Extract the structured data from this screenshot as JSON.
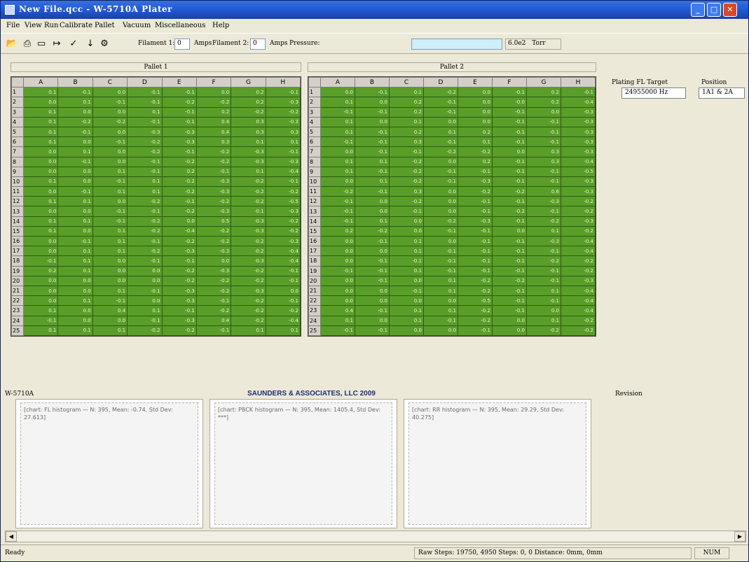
{
  "window": {
    "title": "New File.qcc - W-5710A Plater"
  },
  "menu": [
    "File",
    "View",
    "Run",
    "Calibrate",
    "Pallet",
    "Vacuum",
    "Miscellaneous",
    "Help"
  ],
  "toolbar": {
    "filament1_label": "Filament 1:",
    "filament1_value": "0",
    "amps1_label": "Amps",
    "filament2_label": "Filament 2:",
    "filament2_value": "0",
    "amps2_label": "Amps",
    "pressure_label": "Pressure:",
    "pressure_value": "",
    "pressure_reading": "6.0e2",
    "pressure_unit": "Torr",
    "icons": [
      "open-folder-icon",
      "print-icon",
      "new-document-icon",
      "probe-icon",
      "checkmark-icon",
      "pin-icon",
      "motor-icon"
    ]
  },
  "pallets": [
    {
      "title": "Pallet 1",
      "columns": [
        "A",
        "B",
        "C",
        "D",
        "E",
        "F",
        "G",
        "H"
      ],
      "rows": [
        [
          "0.1",
          "-0.1",
          "0.0",
          "-0.1",
          "-0.1",
          "0.0",
          "0.2",
          "-0.1"
        ],
        [
          "0.0",
          "0.1",
          "-0.1",
          "-0.1",
          "-0.2",
          "-0.2",
          "0.2",
          "-0.3"
        ],
        [
          "0.1",
          "0.0",
          "0.0",
          "0.1",
          "-0.1",
          "0.2",
          "-0.2",
          "-0.2"
        ],
        [
          "0.1",
          "-0.2",
          "-0.2",
          "-0.1",
          "-0.1",
          "0.4",
          "0.3",
          "-0.3"
        ],
        [
          "0.1",
          "-0.1",
          "0.0",
          "-0.3",
          "-0.3",
          "0.4",
          "0.3",
          "0.3"
        ],
        [
          "0.1",
          "0.0",
          "-0.1",
          "-0.2",
          "-0.3",
          "0.3",
          "0.1",
          "0.1"
        ],
        [
          "0.0",
          "0.1",
          "0.0",
          "-0.2",
          "-0.1",
          "-0.2",
          "-0.3",
          "-0.1"
        ],
        [
          "0.0",
          "-0.1",
          "0.0",
          "-0.1",
          "-0.2",
          "-0.2",
          "-0.3",
          "-0.3"
        ],
        [
          "0.0",
          "0.0",
          "0.1",
          "-0.1",
          "0.2",
          "-0.1",
          "0.1",
          "-0.4"
        ],
        [
          "0.1",
          "0.0",
          "-0.1",
          "0.1",
          "-0.2",
          "-0.3",
          "-0.2",
          "-0.1"
        ],
        [
          "0.0",
          "-0.1",
          "0.1",
          "0.1",
          "-0.2",
          "-0.3",
          "-0.2",
          "-0.2"
        ],
        [
          "0.1",
          "0.1",
          "0.0",
          "-0.2",
          "-0.1",
          "-0.2",
          "-0.2",
          "-0.5"
        ],
        [
          "0.0",
          "0.0",
          "-0.1",
          "-0.1",
          "-0.2",
          "-0.3",
          "-0.1",
          "-0.3"
        ],
        [
          "0.1",
          "0.1",
          "-0.1",
          "-0.2",
          "0.0",
          "0.5",
          "-0.3",
          "-0.2"
        ],
        [
          "0.1",
          "0.0",
          "0.1",
          "-0.2",
          "-0.4",
          "-0.2",
          "-0.3",
          "-0.2"
        ],
        [
          "0.0",
          "-0.1",
          "0.1",
          "-0.1",
          "-0.2",
          "-0.2",
          "-0.2",
          "-0.3"
        ],
        [
          "0.0",
          "0.1",
          "0.1",
          "-0.2",
          "-0.3",
          "-0.3",
          "-0.2",
          "-0.4"
        ],
        [
          "-0.1",
          "0.1",
          "0.0",
          "-0.1",
          "-0.1",
          "0.0",
          "-0.3",
          "-0.4"
        ],
        [
          "0.2",
          "0.1",
          "0.0",
          "0.0",
          "-0.2",
          "-0.3",
          "-0.2",
          "-0.1"
        ],
        [
          "0.0",
          "0.0",
          "0.0",
          "0.0",
          "-0.2",
          "-0.2",
          "-0.2",
          "-0.1"
        ],
        [
          "0.0",
          "0.0",
          "0.1",
          "-0.1",
          "-0.3",
          "-0.2",
          "-0.3",
          "0.0"
        ],
        [
          "0.0",
          "0.1",
          "-0.1",
          "0.0",
          "-0.3",
          "-0.1",
          "-0.2",
          "-0.1"
        ],
        [
          "0.1",
          "0.0",
          "0.4",
          "0.1",
          "-0.1",
          "-0.2",
          "-0.2",
          "-0.2"
        ],
        [
          "-0.1",
          "0.0",
          "0.0",
          "-0.1",
          "-0.3",
          "0.4",
          "-0.2",
          "-0.4"
        ],
        [
          "0.1",
          "0.1",
          "0.1",
          "-0.2",
          "-0.2",
          "-0.1",
          "0.1",
          "0.1"
        ]
      ]
    },
    {
      "title": "Pallet 2",
      "columns": [
        "A",
        "B",
        "C",
        "D",
        "E",
        "F",
        "G",
        "H"
      ],
      "rows": [
        [
          "0.0",
          "-0.1",
          "0.1",
          "-0.2",
          "0.0",
          "-0.1",
          "0.2",
          "-0.1"
        ],
        [
          "0.1",
          "0.0",
          "0.2",
          "-0.1",
          "0.0",
          "-0.0",
          "0.2",
          "-0.4"
        ],
        [
          "-0.1",
          "-0.1",
          "0.2",
          "-0.1",
          "0.0",
          "-0.1",
          "0.0",
          "-0.3"
        ],
        [
          "0.1",
          "0.0",
          "0.1",
          "0.0",
          "0.0",
          "-0.1",
          "-0.1",
          "-0.3"
        ],
        [
          "0.1",
          "-0.1",
          "0.2",
          "0.1",
          "0.2",
          "-0.1",
          "-0.1",
          "-0.3"
        ],
        [
          "-0.1",
          "-0.1",
          "0.3",
          "-0.1",
          "0.1",
          "-0.1",
          "-0.1",
          "-0.3"
        ],
        [
          "0.0",
          "-0.1",
          "-0.1",
          "-0.2",
          "-0.2",
          "0.0",
          "0.3",
          "-0.3"
        ],
        [
          "0.1",
          "0.1",
          "-0.2",
          "0.0",
          "0.2",
          "-0.1",
          "0.3",
          "-0.4"
        ],
        [
          "0.1",
          "-0.1",
          "-0.2",
          "-0.1",
          "-0.1",
          "-0.1",
          "-0.1",
          "-0.5"
        ],
        [
          "0.0",
          "0.1",
          "-0.2",
          "-0.1",
          "-0.3",
          "-0.1",
          "-0.1",
          "-0.3"
        ],
        [
          "-0.2",
          "-0.1",
          "0.3",
          "0.0",
          "-0.2",
          "-0.2",
          "0.6",
          "-0.3"
        ],
        [
          "-0.1",
          "0.0",
          "-0.2",
          "0.0",
          "-0.1",
          "-0.1",
          "-0.3",
          "-0.2"
        ],
        [
          "-0.1",
          "0.0",
          "-0.1",
          "0.0",
          "-0.1",
          "-0.2",
          "-0.1",
          "-0.2"
        ],
        [
          "-0.1",
          "0.1",
          "0.0",
          "-0.2",
          "-0.3",
          "-0.1",
          "-0.2",
          "-0.3"
        ],
        [
          "0.2",
          "-0.2",
          "0.0",
          "-0.1",
          "-0.1",
          "0.0",
          "0.1",
          "-0.2"
        ],
        [
          "0.0",
          "-0.1",
          "0.1",
          "0.0",
          "-0.1",
          "-0.1",
          "-0.3",
          "-0.4"
        ],
        [
          "0.0",
          "0.0",
          "0.1",
          "-0.1",
          "-0.1",
          "-0.1",
          "-0.1",
          "-0.4"
        ],
        [
          "0.0",
          "-0.1",
          "-0.1",
          "-0.1",
          "-0.1",
          "-0.1",
          "-0.2",
          "-0.2"
        ],
        [
          "-0.1",
          "-0.1",
          "0.1",
          "-0.1",
          "-0.1",
          "-0.1",
          "-0.1",
          "-0.2"
        ],
        [
          "0.0",
          "-0.1",
          "0.0",
          "0.1",
          "-0.2",
          "-0.2",
          "-0.1",
          "-0.3"
        ],
        [
          "0.0",
          "0.0",
          "-0.1",
          "0.1",
          "-0.2",
          "-0.1",
          "0.1",
          "-0.4"
        ],
        [
          "0.0",
          "0.0",
          "0.0",
          "0.0",
          "-0.5",
          "-0.1",
          "-0.1",
          "-0.4"
        ],
        [
          "0.4",
          "-0.1",
          "0.1",
          "0.1",
          "-0.2",
          "-0.1",
          "0.0",
          "-0.4"
        ],
        [
          "0.1",
          "0.0",
          "0.1",
          "-0.1",
          "-0.2",
          "0.0",
          "0.1",
          "-0.2"
        ],
        [
          "-0.1",
          "-0.1",
          "0.0",
          "0.0",
          "-0.1",
          "0.0",
          "-0.2",
          "-0.2"
        ]
      ]
    }
  ],
  "sidebar": {
    "plating_target_label": "Plating FL Target",
    "plating_target_value": "24955000  Hz",
    "position_label": "Position",
    "position_value": "1A1 & 2A"
  },
  "footer": {
    "model": "W-5710A",
    "company": "SAUNDERS & ASSOCIATES, LLC  2009",
    "revision": "Revision"
  },
  "chart_placeholders": [
    {
      "text": "[chart: FL histogram — N: 395, Mean: -0.74, Std Dev: 27.613]"
    },
    {
      "text": "[chart: PBCK histogram — N: 395, Mean: 1405.4, Std Dev: ***]"
    },
    {
      "text": "[chart: RR histogram — N: 395, Mean: 29.29, Std Dev: 40.275]"
    }
  ],
  "status": {
    "ready": "Ready",
    "steps_panel": "Raw Steps: 19750, 4950  Steps: 0, 0  Distance: 0mm, 0mm",
    "num": "NUM"
  }
}
